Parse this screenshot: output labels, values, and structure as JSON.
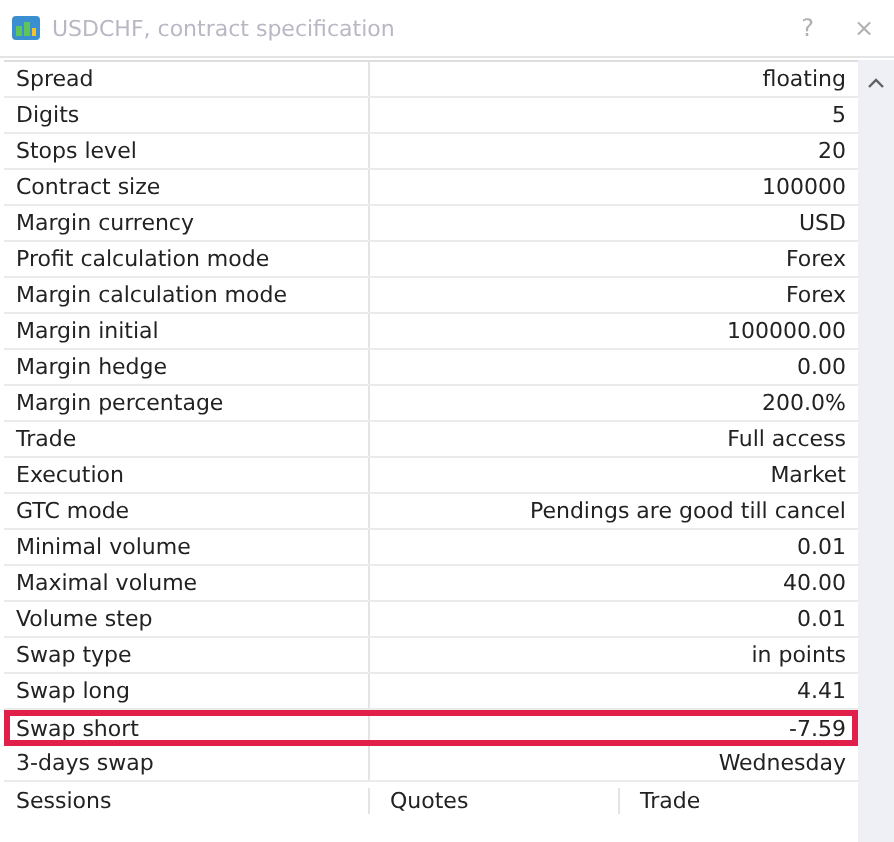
{
  "window": {
    "title": "USDCHF, contract specification",
    "buttons": [
      "?",
      "×"
    ]
  },
  "rows": [
    {
      "label": "Spread",
      "value": "floating",
      "highlighted": false
    },
    {
      "label": "Digits",
      "value": "5",
      "highlighted": false
    },
    {
      "label": "Stops level",
      "value": "20",
      "highlighted": false
    },
    {
      "label": "Contract size",
      "value": "100000",
      "highlighted": false
    },
    {
      "label": "Margin currency",
      "value": "USD",
      "highlighted": false
    },
    {
      "label": "Profit calculation mode",
      "value": "Forex",
      "highlighted": false
    },
    {
      "label": "Margin calculation mode",
      "value": "Forex",
      "highlighted": false
    },
    {
      "label": "Margin initial",
      "value": "100000.00",
      "highlighted": false
    },
    {
      "label": "Margin hedge",
      "value": "0.00",
      "highlighted": false
    },
    {
      "label": "Margin percentage",
      "value": "200.0%",
      "highlighted": false
    },
    {
      "label": "Trade",
      "value": "Full access",
      "highlighted": false
    },
    {
      "label": "Execution",
      "value": "Market",
      "highlighted": false
    },
    {
      "label": "GTC mode",
      "value": "Pendings are good till cancel",
      "highlighted": false
    },
    {
      "label": "Minimal volume",
      "value": "0.01",
      "highlighted": false
    },
    {
      "label": "Maximal volume",
      "value": "40.00",
      "highlighted": false
    },
    {
      "label": "Volume step",
      "value": "0.01",
      "highlighted": false
    },
    {
      "label": "Swap type",
      "value": "in points",
      "highlighted": false
    },
    {
      "label": "Swap long",
      "value": "4.41",
      "highlighted": false
    },
    {
      "label": "Swap short",
      "value": "-7.59",
      "highlighted": true
    },
    {
      "label": "3-days swap",
      "value": "Wednesday",
      "highlighted": false
    }
  ],
  "sessions_header": [
    "Sessions",
    "Quotes",
    "Trade"
  ]
}
